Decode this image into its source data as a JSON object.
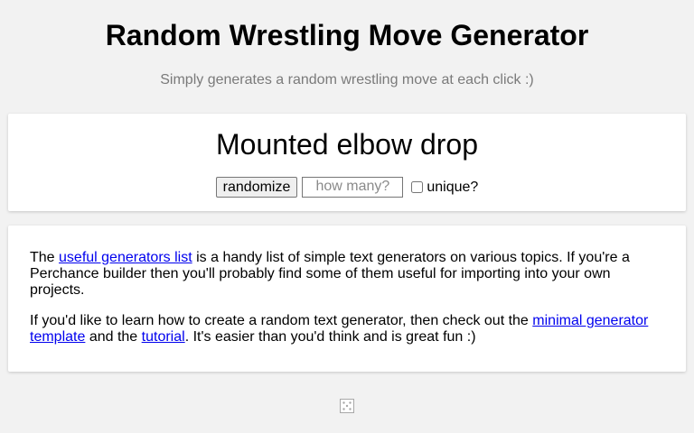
{
  "header": {
    "title": "Random Wrestling Move Generator",
    "subtitle": "Simply generates a random wrestling move at each click :)"
  },
  "generator": {
    "result": "Mounted elbow drop",
    "randomize_label": "randomize",
    "count_placeholder": "how many?",
    "unique_label": "unique?",
    "unique_checked": false
  },
  "info": {
    "p1_text1": "The ",
    "p1_link": "useful generators list",
    "p1_text2": " is a handy list of simple text generators on various topics. If you're a Perchance builder then you'll probably find some of them useful for importing into your own projects.",
    "p2_text1": "If you'd like to learn how to create a random text generator, then check out the ",
    "p2_link1": "minimal generator template",
    "p2_text2": " and the ",
    "p2_link2": "tutorial",
    "p2_text3": ". It's easier than you'd think and is great fun :)"
  },
  "footer": {
    "icon": "dice-icon"
  }
}
